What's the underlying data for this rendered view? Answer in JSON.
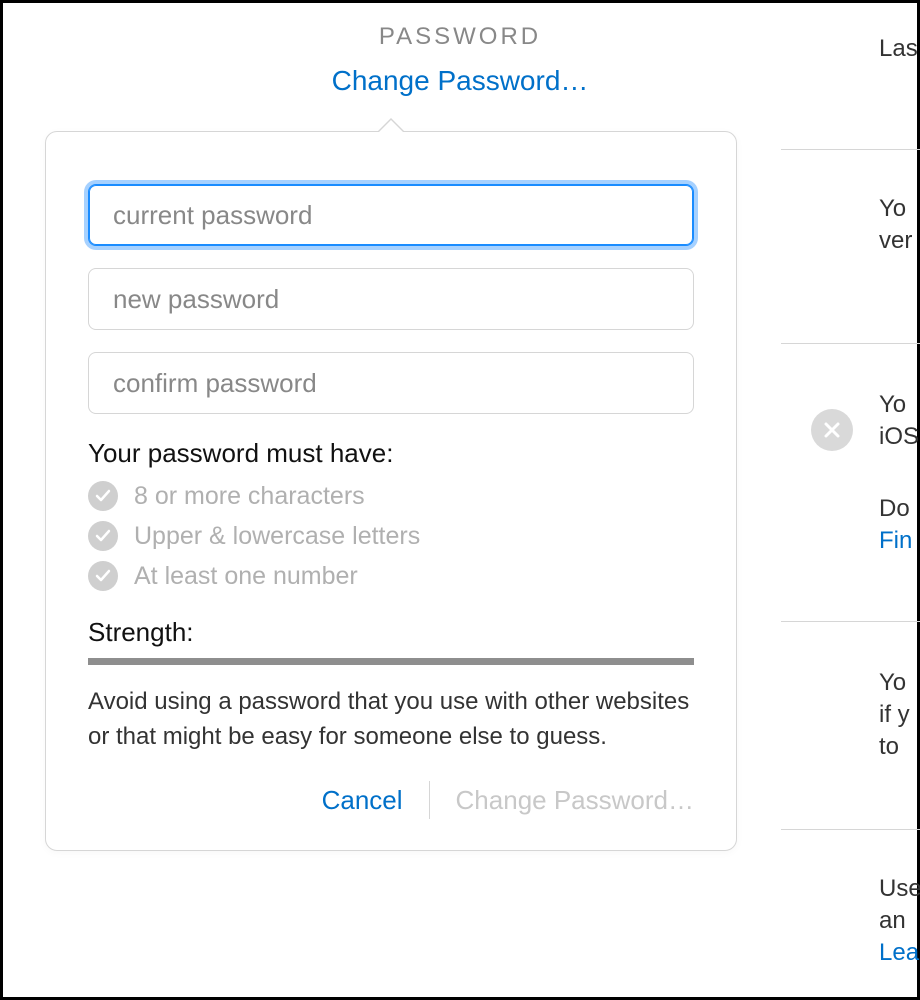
{
  "header": {
    "section_title": "PASSWORD",
    "change_link": "Change Password…"
  },
  "popover": {
    "fields": {
      "current_placeholder": "current password",
      "new_placeholder": "new password",
      "confirm_placeholder": "confirm password"
    },
    "requirements_title": "Your password must have:",
    "requirements": [
      "8 or more characters",
      "Upper & lowercase letters",
      "At least one number"
    ],
    "strength_label": "Strength:",
    "hint": "Avoid using a password that you use with other websites or that might be easy for someone else to guess.",
    "cancel_label": "Cancel",
    "submit_label": "Change Password…"
  },
  "right": {
    "r1": "Las",
    "r2a": "Yo",
    "r2b": "ver",
    "r3a": "Yo",
    "r3b": "iOS",
    "r3c": "Do",
    "r3d": "Fin",
    "r4a": "Yo",
    "r4b": "if y",
    "r4c": "to ",
    "r5a": "Use",
    "r5b": "an ",
    "r5c": "Lea"
  }
}
